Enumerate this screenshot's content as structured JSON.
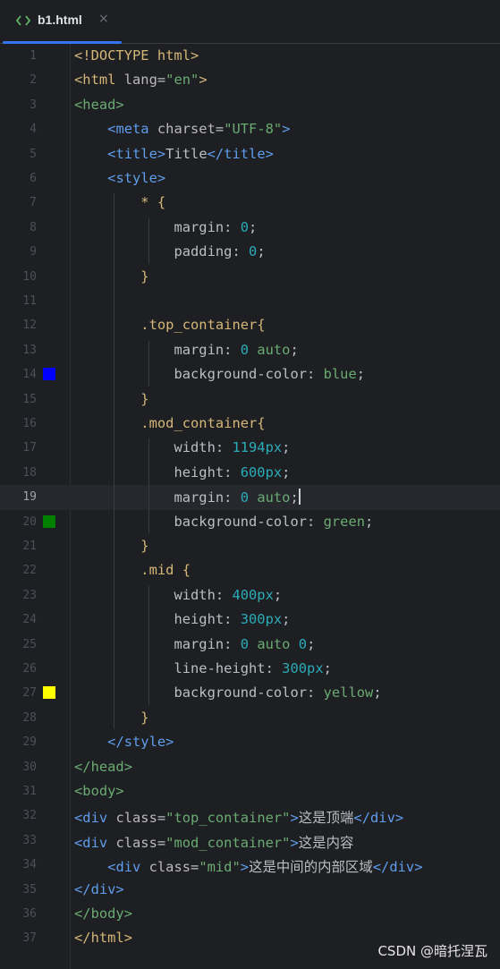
{
  "tab": {
    "label": "b1.html",
    "icon": "html-file-icon",
    "close": "×"
  },
  "current_line": 19,
  "lines": [
    {
      "n": "1",
      "tokens": [
        [
          "tag",
          "<!DOCTYPE html>"
        ]
      ]
    },
    {
      "n": "2",
      "tokens": [
        [
          "tag",
          "<html "
        ],
        [
          "attr",
          "lang"
        ],
        [
          "txt",
          "="
        ],
        [
          "str",
          "\"en\""
        ],
        [
          "tag",
          ">"
        ]
      ]
    },
    {
      "n": "3",
      "tokens": [
        [
          "kw",
          "<head>"
        ]
      ]
    },
    {
      "n": "4",
      "tokens": [
        [
          "txt",
          "    "
        ],
        [
          "blue",
          "<meta "
        ],
        [
          "attr",
          "charset"
        ],
        [
          "txt",
          "="
        ],
        [
          "str",
          "\"UTF-8\""
        ],
        [
          "blue",
          ">"
        ]
      ]
    },
    {
      "n": "5",
      "tokens": [
        [
          "txt",
          "    "
        ],
        [
          "blue",
          "<title>"
        ],
        [
          "txt",
          "Title"
        ],
        [
          "blue",
          "</title>"
        ]
      ]
    },
    {
      "n": "6",
      "tokens": [
        [
          "txt",
          "    "
        ],
        [
          "blue",
          "<style>"
        ]
      ]
    },
    {
      "n": "7",
      "tokens": [
        [
          "txt",
          "        "
        ],
        [
          "sel",
          "* {"
        ]
      ]
    },
    {
      "n": "8",
      "tokens": [
        [
          "txt",
          "            "
        ],
        [
          "prop",
          "margin"
        ],
        [
          "txt",
          ": "
        ],
        [
          "num",
          "0"
        ],
        [
          "txt",
          ";"
        ]
      ]
    },
    {
      "n": "9",
      "tokens": [
        [
          "txt",
          "            "
        ],
        [
          "prop",
          "padding"
        ],
        [
          "txt",
          ": "
        ],
        [
          "num",
          "0"
        ],
        [
          "txt",
          ";"
        ]
      ]
    },
    {
      "n": "10",
      "tokens": [
        [
          "txt",
          "        "
        ],
        [
          "sel",
          "}"
        ]
      ]
    },
    {
      "n": "11",
      "tokens": []
    },
    {
      "n": "12",
      "tokens": [
        [
          "txt",
          "        "
        ],
        [
          "sel",
          ".top_container{"
        ]
      ]
    },
    {
      "n": "13",
      "tokens": [
        [
          "txt",
          "            "
        ],
        [
          "prop",
          "margin"
        ],
        [
          "txt",
          ": "
        ],
        [
          "num",
          "0"
        ],
        [
          "txt",
          " "
        ],
        [
          "kw",
          "auto"
        ],
        [
          "txt",
          ";"
        ]
      ]
    },
    {
      "n": "14",
      "tokens": [
        [
          "txt",
          "            "
        ],
        [
          "prop",
          "background-color"
        ],
        [
          "txt",
          ": "
        ],
        [
          "kw",
          "blue"
        ],
        [
          "txt",
          ";"
        ]
      ],
      "swatch": "#0000ff"
    },
    {
      "n": "15",
      "tokens": [
        [
          "txt",
          "        "
        ],
        [
          "sel",
          "}"
        ]
      ]
    },
    {
      "n": "16",
      "tokens": [
        [
          "txt",
          "        "
        ],
        [
          "sel",
          ".mod_container{"
        ]
      ]
    },
    {
      "n": "17",
      "tokens": [
        [
          "txt",
          "            "
        ],
        [
          "prop",
          "width"
        ],
        [
          "txt",
          ": "
        ],
        [
          "num",
          "1194px"
        ],
        [
          "txt",
          ";"
        ]
      ]
    },
    {
      "n": "18",
      "tokens": [
        [
          "txt",
          "            "
        ],
        [
          "prop",
          "height"
        ],
        [
          "txt",
          ": "
        ],
        [
          "num",
          "600px"
        ],
        [
          "txt",
          ";"
        ]
      ]
    },
    {
      "n": "19",
      "tokens": [
        [
          "txt",
          "            "
        ],
        [
          "prop",
          "margin"
        ],
        [
          "txt",
          ": "
        ],
        [
          "num",
          "0"
        ],
        [
          "txt",
          " "
        ],
        [
          "kw",
          "auto"
        ],
        [
          "txt",
          ";"
        ]
      ],
      "caret": true
    },
    {
      "n": "20",
      "tokens": [
        [
          "txt",
          "            "
        ],
        [
          "prop",
          "background-color"
        ],
        [
          "txt",
          ": "
        ],
        [
          "kw",
          "green"
        ],
        [
          "txt",
          ";"
        ]
      ],
      "swatch": "#008000"
    },
    {
      "n": "21",
      "tokens": [
        [
          "txt",
          "        "
        ],
        [
          "sel",
          "}"
        ]
      ]
    },
    {
      "n": "22",
      "tokens": [
        [
          "txt",
          "        "
        ],
        [
          "sel",
          ".mid {"
        ]
      ]
    },
    {
      "n": "23",
      "tokens": [
        [
          "txt",
          "            "
        ],
        [
          "prop",
          "width"
        ],
        [
          "txt",
          ": "
        ],
        [
          "num",
          "400px"
        ],
        [
          "txt",
          ";"
        ]
      ]
    },
    {
      "n": "24",
      "tokens": [
        [
          "txt",
          "            "
        ],
        [
          "prop",
          "height"
        ],
        [
          "txt",
          ": "
        ],
        [
          "num",
          "300px"
        ],
        [
          "txt",
          ";"
        ]
      ]
    },
    {
      "n": "25",
      "tokens": [
        [
          "txt",
          "            "
        ],
        [
          "prop",
          "margin"
        ],
        [
          "txt",
          ": "
        ],
        [
          "num",
          "0"
        ],
        [
          "txt",
          " "
        ],
        [
          "kw",
          "auto"
        ],
        [
          "txt",
          " "
        ],
        [
          "num",
          "0"
        ],
        [
          "txt",
          ";"
        ]
      ]
    },
    {
      "n": "26",
      "tokens": [
        [
          "txt",
          "            "
        ],
        [
          "prop",
          "line-height"
        ],
        [
          "txt",
          ": "
        ],
        [
          "num",
          "300px"
        ],
        [
          "txt",
          ";"
        ]
      ]
    },
    {
      "n": "27",
      "tokens": [
        [
          "txt",
          "            "
        ],
        [
          "prop",
          "background-color"
        ],
        [
          "txt",
          ": "
        ],
        [
          "kw",
          "yellow"
        ],
        [
          "txt",
          ";"
        ]
      ],
      "swatch": "#ffff00"
    },
    {
      "n": "28",
      "tokens": [
        [
          "txt",
          "        "
        ],
        [
          "sel",
          "}"
        ]
      ]
    },
    {
      "n": "29",
      "tokens": [
        [
          "txt",
          "    "
        ],
        [
          "blue",
          "</style>"
        ]
      ]
    },
    {
      "n": "30",
      "tokens": [
        [
          "kw",
          "</head>"
        ]
      ]
    },
    {
      "n": "31",
      "tokens": [
        [
          "kw",
          "<body>"
        ]
      ]
    },
    {
      "n": "32",
      "tokens": [
        [
          "blue",
          "<div "
        ],
        [
          "attr",
          "class"
        ],
        [
          "txt",
          "="
        ],
        [
          "str",
          "\"top_container\""
        ],
        [
          "blue",
          ">"
        ],
        [
          "txt",
          "这是顶端"
        ],
        [
          "blue",
          "</div>"
        ]
      ]
    },
    {
      "n": "33",
      "tokens": [
        [
          "blue",
          "<div "
        ],
        [
          "attr",
          "class"
        ],
        [
          "txt",
          "="
        ],
        [
          "str",
          "\"mod_container\""
        ],
        [
          "blue",
          ">"
        ],
        [
          "txt",
          "这是内容"
        ]
      ]
    },
    {
      "n": "34",
      "tokens": [
        [
          "txt",
          "    "
        ],
        [
          "blue",
          "<div "
        ],
        [
          "attr",
          "class"
        ],
        [
          "txt",
          "="
        ],
        [
          "str",
          "\"mid\""
        ],
        [
          "blue",
          ">"
        ],
        [
          "txt",
          "这是中间的内部区域"
        ],
        [
          "blue",
          "</div>"
        ]
      ]
    },
    {
      "n": "35",
      "tokens": [
        [
          "blue",
          "</div>"
        ]
      ]
    },
    {
      "n": "36",
      "tokens": [
        [
          "kw",
          "</body>"
        ]
      ]
    },
    {
      "n": "37",
      "tokens": [
        [
          "tag",
          "</html>"
        ]
      ]
    }
  ],
  "watermark": "CSDN @暗托涅瓦"
}
